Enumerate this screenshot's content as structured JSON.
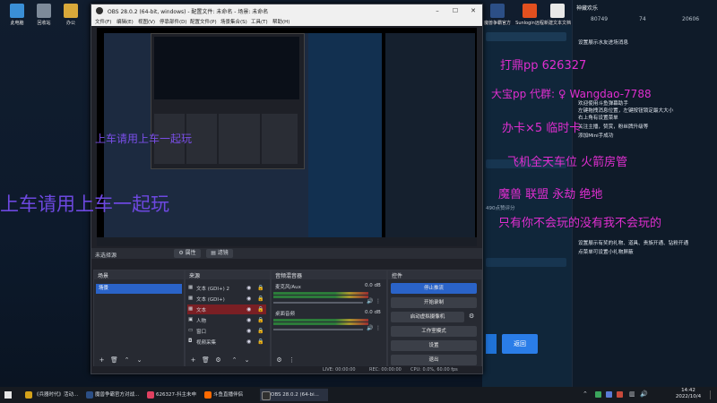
{
  "desktop": {
    "icons": [
      {
        "label": "此电脑",
        "color": "#3a8fd6"
      },
      {
        "label": "回收站",
        "color": "#7d8a99"
      },
      {
        "label": "办公",
        "color": "#d9a93a"
      }
    ],
    "top_right_icons": [
      {
        "label": "魔兽争霸官方对战平台",
        "color": "#2c4f86"
      },
      {
        "label": "Sunlogin远程控...",
        "color": "#e2501f"
      },
      {
        "label": "新建文本文档",
        "color": "#e8e8e8"
      }
    ]
  },
  "obs": {
    "title": "OBS 28.0.2 (64-bit, windows) - 配置文件: 未命名 - 场景: 未命名",
    "menu": [
      "文件(F)",
      "编辑(E)",
      "视图(V)",
      "停靠部件(D)",
      "配置文件(P)",
      "场景集合(S)",
      "工具(T)",
      "帮助(H)"
    ],
    "source_strip": {
      "label": "未选择源",
      "properties": "属性",
      "filters": "滤镜"
    },
    "panels": {
      "scenes": {
        "title": "场景",
        "items": [
          "场景"
        ]
      },
      "sources": {
        "title": "来源",
        "items": [
          {
            "name": "文本 (GDI+) 2"
          },
          {
            "name": "文本 (GDI+)"
          },
          {
            "name": "文本"
          },
          {
            "name": "人物"
          },
          {
            "name": "窗口"
          },
          {
            "name": "视频采集"
          }
        ]
      },
      "mixer": {
        "title": "音频混音器",
        "channels": [
          {
            "name": "麦克风/Aux",
            "level": "0.0 dB"
          },
          {
            "name": "桌面音频",
            "level": "0.0 dB"
          }
        ]
      },
      "controls": {
        "title": "控件",
        "buttons": [
          "停止推流",
          "开始录制",
          "启动虚拟摄像机",
          "工作室模式",
          "设置",
          "退出"
        ]
      }
    },
    "status": {
      "live": "LIVE: 00:00:00",
      "rec": "REC: 00:00:00",
      "cpu": "CPU: 0.0%, 60.00 fps"
    }
  },
  "overlays": {
    "slogan": "上车请用上车一起玩",
    "lines": [
      "打鼎pp 626327",
      "大宝pp 代群: ♀ Wangdao-7788",
      "办卡×5 临时卡",
      "飞机全天车位 火箭房管",
      "魔兽 联盟 永劫 绝地",
      "只有你不会玩的没有我不会玩的"
    ]
  },
  "chat": {
    "title": "神藏欢乐",
    "stats": [
      "80749",
      "74",
      "20606"
    ],
    "messages": [
      "设置展示水友进场消息",
      "欢迎使用斗鱼弹幕助手",
      "左键拖拽消息位置，左键按钮锁定最大大小",
      "右上角有设置菜单",
      "关注主播，赞赏，粉丝牌升级等",
      "添加Mini手成功",
      "设置展示有奖的礼物、道具、贵族开通、钻粉开通",
      "点菜单可设置小礼物屏蔽"
    ],
    "clock_time": "14:42",
    "clock_date": "2022/10/4"
  },
  "stream_panel": {
    "rating": "490点赞评分",
    "return_button": "返回"
  },
  "taskbar": {
    "items": [
      {
        "label": "《兵器时代》活动...",
        "color": "#d4a21a"
      },
      {
        "label": "魔兽争霸官方对战...",
        "color": "#2c4f86"
      },
      {
        "label": "626327-抖主未申",
        "color": "#e04060"
      },
      {
        "label": "斗鱼直播伴侣",
        "color": "#ff6a00"
      },
      {
        "label": "OBS 28.0.2 (64-bi...",
        "color": "#303030"
      }
    ]
  }
}
